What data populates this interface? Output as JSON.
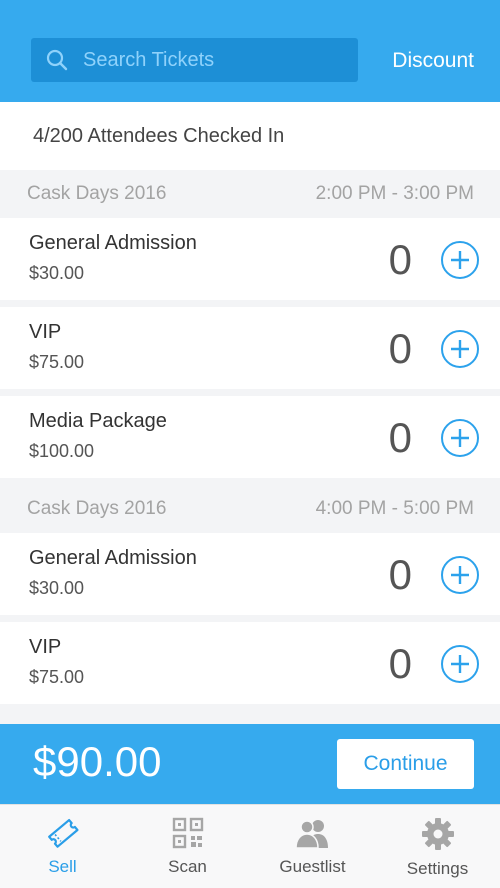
{
  "header": {
    "search_placeholder": "Search Tickets",
    "discount_label": "Discount"
  },
  "status": {
    "checked_in_text": "4/200 Attendees Checked In"
  },
  "sections": [
    {
      "event": "Cask Days 2016",
      "time": "2:00 PM - 3:00 PM",
      "tickets": [
        {
          "name": "General Admission",
          "price": "$30.00",
          "qty": "0"
        },
        {
          "name": "VIP",
          "price": "$75.00",
          "qty": "0"
        },
        {
          "name": "Media Package",
          "price": "$100.00",
          "qty": "0"
        }
      ]
    },
    {
      "event": "Cask Days 2016",
      "time": "4:00 PM - 5:00 PM",
      "tickets": [
        {
          "name": "General Admission",
          "price": "$30.00",
          "qty": "0"
        },
        {
          "name": "VIP",
          "price": "$75.00",
          "qty": "0"
        }
      ]
    }
  ],
  "footer": {
    "total": "$90.00",
    "continue_label": "Continue"
  },
  "tabs": [
    {
      "label": "Sell",
      "icon": "ticket-icon",
      "active": true
    },
    {
      "label": "Scan",
      "icon": "qr-code-icon",
      "active": false
    },
    {
      "label": "Guestlist",
      "icon": "people-icon",
      "active": false
    },
    {
      "label": "Settings",
      "icon": "gear-icon",
      "active": false
    }
  ],
  "colors": {
    "brand_blue": "#36aaee",
    "search_bg": "#1d8fd6",
    "accent": "#2a9ee8",
    "inactive_icon": "#a6a6a6"
  }
}
